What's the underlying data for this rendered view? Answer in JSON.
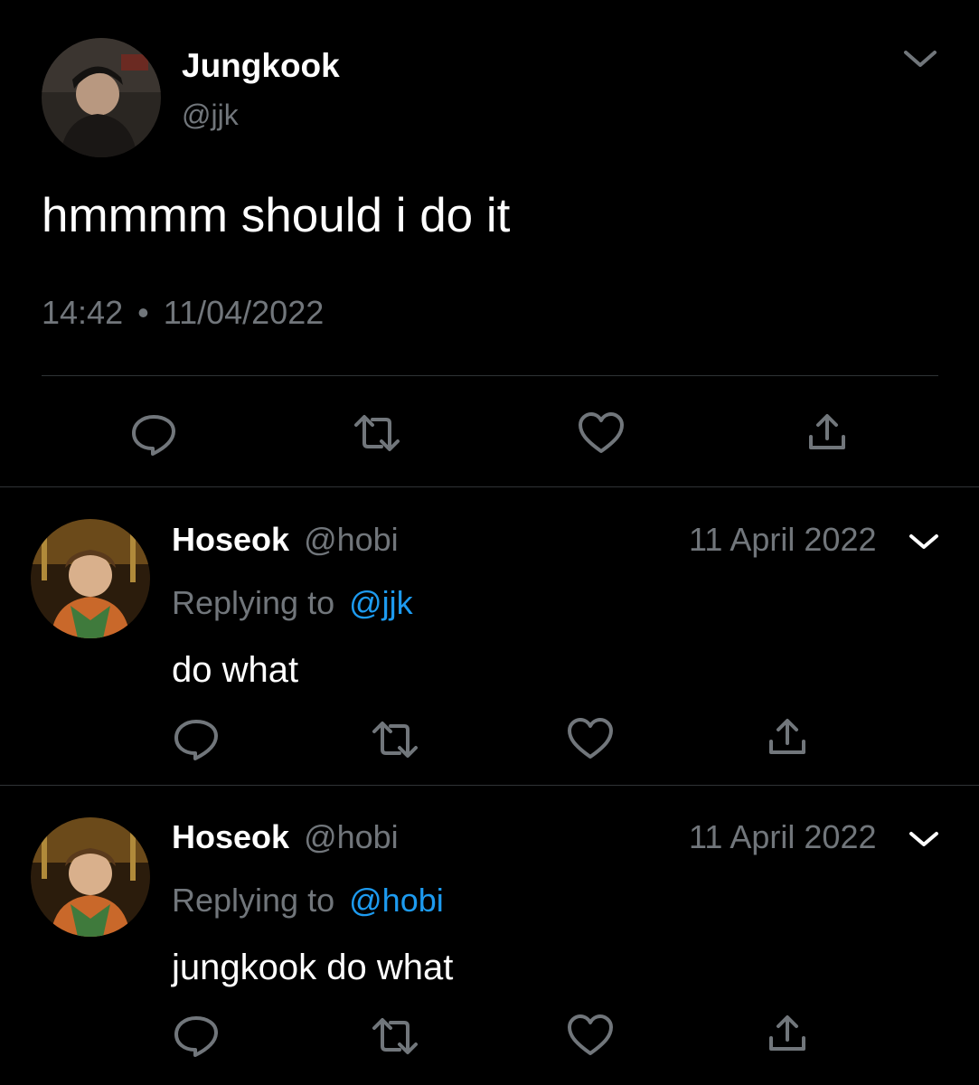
{
  "colors": {
    "background": "#000000",
    "text": "#ffffff",
    "muted": "#71767b",
    "link": "#1d9bf0",
    "divider": "#2f3336"
  },
  "main_tweet": {
    "name": "Jungkook",
    "handle": "@jjk",
    "text": "hmmmm should i do it",
    "time": "14:42",
    "separator": "•",
    "date": "11/04/2022",
    "menu_icon": "chevron-down-icon",
    "actions": [
      "reply-icon",
      "retweet-icon",
      "like-icon",
      "share-icon"
    ]
  },
  "replies": [
    {
      "name": "Hoseok",
      "handle": "@hobi",
      "date": "11 April 2022",
      "replying_label": "Replying to",
      "replying_to": "@jjk",
      "text": "do what"
    },
    {
      "name": "Hoseok",
      "handle": "@hobi",
      "date": "11 April 2022",
      "replying_label": "Replying to",
      "replying_to": "@hobi",
      "text": "jungkook do what"
    }
  ]
}
